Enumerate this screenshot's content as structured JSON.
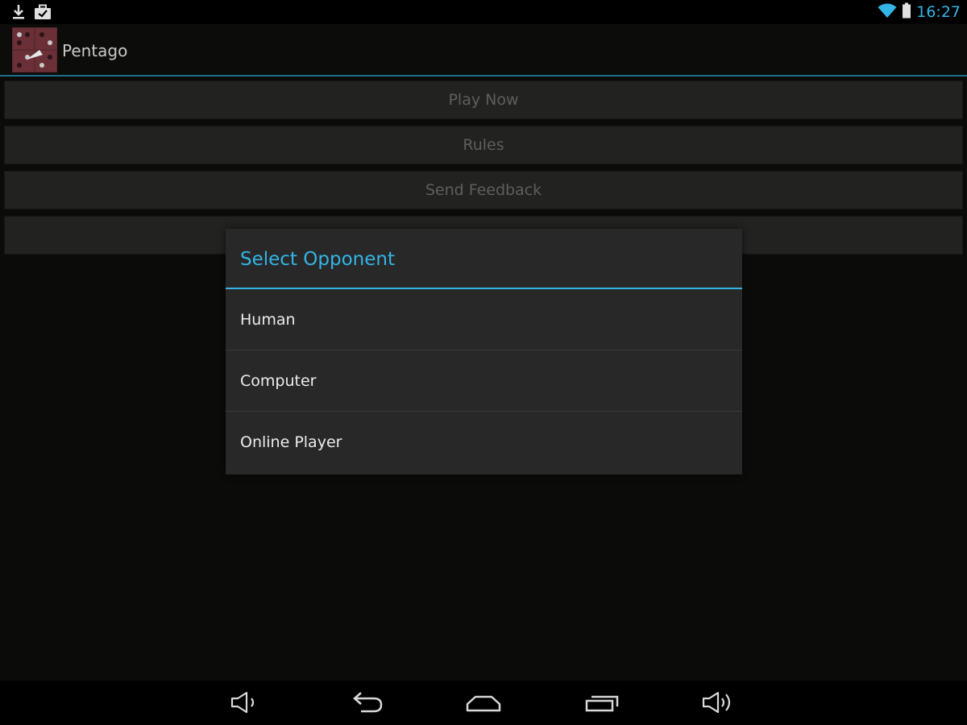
{
  "status_bar": {
    "icons_left": [
      "download-icon",
      "briefcase-check-icon"
    ],
    "icons_right": [
      "wifi-icon",
      "battery-icon"
    ],
    "time": "16:27",
    "accent": "#33b5e5"
  },
  "action_bar": {
    "title": "Pentago",
    "icon": "pentago-app-icon"
  },
  "menu": {
    "items": [
      "Play Now",
      "Rules",
      "Send Feedback",
      ""
    ]
  },
  "dialog": {
    "title": "Select Opponent",
    "options": [
      "Human",
      "Computer",
      "Online Player"
    ]
  },
  "nav_bar": {
    "buttons": [
      "volume-down-icon",
      "back-icon",
      "home-icon",
      "recent-apps-icon",
      "volume-up-icon"
    ]
  },
  "colors": {
    "accent": "#33b5e5",
    "background": "#0b0b09",
    "dialog_bg": "#282828"
  }
}
